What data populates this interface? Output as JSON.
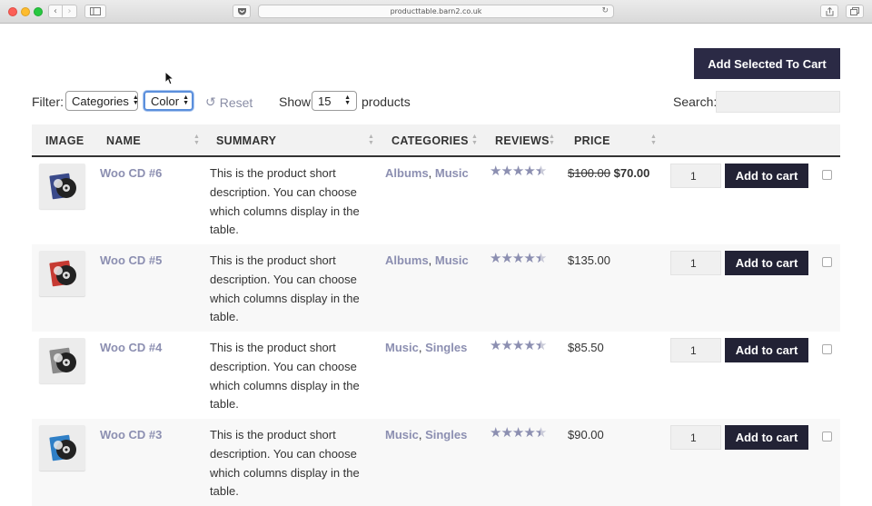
{
  "browser": {
    "url": "producttable.barn2.co.uk",
    "icons": [
      "back-icon",
      "forward-icon",
      "sidebar-icon",
      "pocket-icon",
      "reload-icon",
      "share-icon",
      "tabs-icon"
    ]
  },
  "toolbar": {
    "add_selected_label": "Add Selected To Cart"
  },
  "filters": {
    "filter_label": "Filter:",
    "categories_value": "Categories",
    "color_value": "Color",
    "reset_label": "Reset",
    "show_label": "Show",
    "show_value": "15",
    "products_label": "products",
    "search_label": "Search:",
    "search_value": ""
  },
  "table": {
    "columns": [
      "IMAGE",
      "NAME",
      "SUMMARY",
      "CATEGORIES",
      "REVIEWS",
      "PRICE"
    ],
    "rows": [
      {
        "name": "Woo CD #6",
        "summary": "This is the product short description. You can choose which columns display in the table.",
        "categories": [
          "Albums",
          "Music"
        ],
        "rating": 4.5,
        "price_old": "$100.00",
        "price": "$70.00",
        "qty": "1",
        "cd_color": "#3a4a8a",
        "button": "Add to cart"
      },
      {
        "name": "Woo CD #5",
        "summary": "This is the product short description. You can choose which columns display in the table.",
        "categories": [
          "Albums",
          "Music"
        ],
        "rating": 4.5,
        "price_old": "",
        "price": "$135.00",
        "qty": "1",
        "cd_color": "#c63a32",
        "button": "Add to cart"
      },
      {
        "name": "Woo CD #4",
        "summary": "This is the product short description. You can choose which columns display in the table.",
        "categories": [
          "Music",
          "Singles"
        ],
        "rating": 4.5,
        "price_old": "",
        "price": "$85.50",
        "qty": "1",
        "cd_color": "#8a8a8a",
        "button": "Add to cart"
      },
      {
        "name": "Woo CD #3",
        "summary": "This is the product short description. You can choose which columns display in the table.",
        "categories": [
          "Music",
          "Singles"
        ],
        "rating": 4.5,
        "price_old": "",
        "price": "$90.00",
        "qty": "1",
        "cd_color": "#2f7fc6",
        "button": "Add to cart"
      }
    ]
  },
  "colors": {
    "accent": "#8c8fb1",
    "button_dark": "#222235",
    "add_selected_bg": "#2b2a45"
  }
}
